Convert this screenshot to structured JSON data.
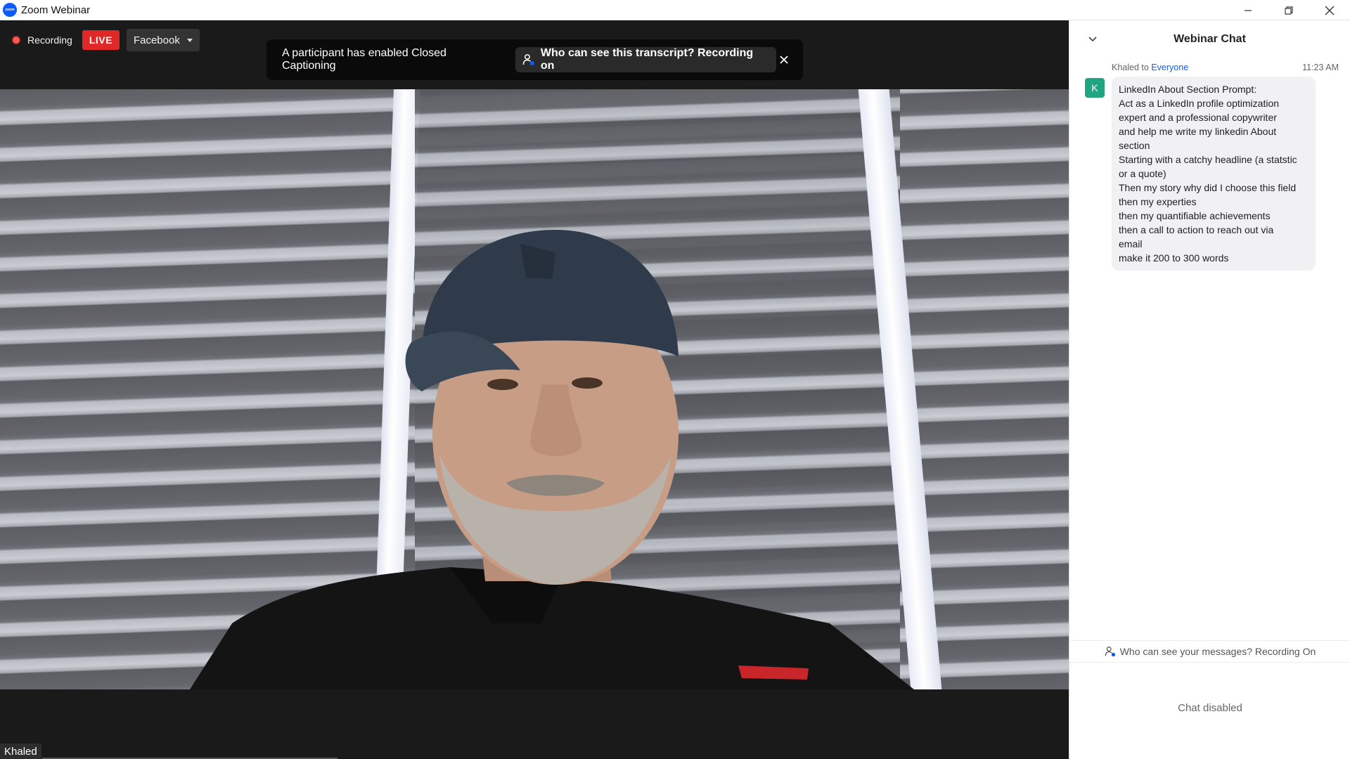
{
  "window": {
    "title": "Zoom Webinar",
    "logo_text": "zoom"
  },
  "stage": {
    "recording_label": "Recording",
    "live_label": "LIVE",
    "stream_target": "Facebook",
    "caption_banner": {
      "text": "A participant has enabled Closed Captioning",
      "transcript_pill": "Who can see this transcript? Recording on"
    },
    "participant_name": "Khaled"
  },
  "chat": {
    "title": "Webinar Chat",
    "message": {
      "sender": "Khaled",
      "to_word": "to",
      "recipient": "Everyone",
      "time": "11:23 AM",
      "avatar_letter": "K",
      "lines": [
        "LinkedIn About Section Prompt:",
        "Act as a LinkedIn profile optimization",
        "expert and a professional copywriter",
        "and help me write my linkedin About",
        "section",
        "Starting with a catchy headline (a statstic",
        "or a quote)",
        "Then my story why did I choose this field",
        "then my experties",
        "then my quantifiable achievements",
        "then a call to action to reach out via",
        "email",
        "make it 200 to 300 words"
      ]
    },
    "privacy_notice": "Who can see your messages? Recording On",
    "disabled_text": "Chat disabled"
  },
  "colors": {
    "live_red": "#e02828",
    "recipient_blue": "#0b5cff",
    "avatar_green": "#20a482"
  }
}
